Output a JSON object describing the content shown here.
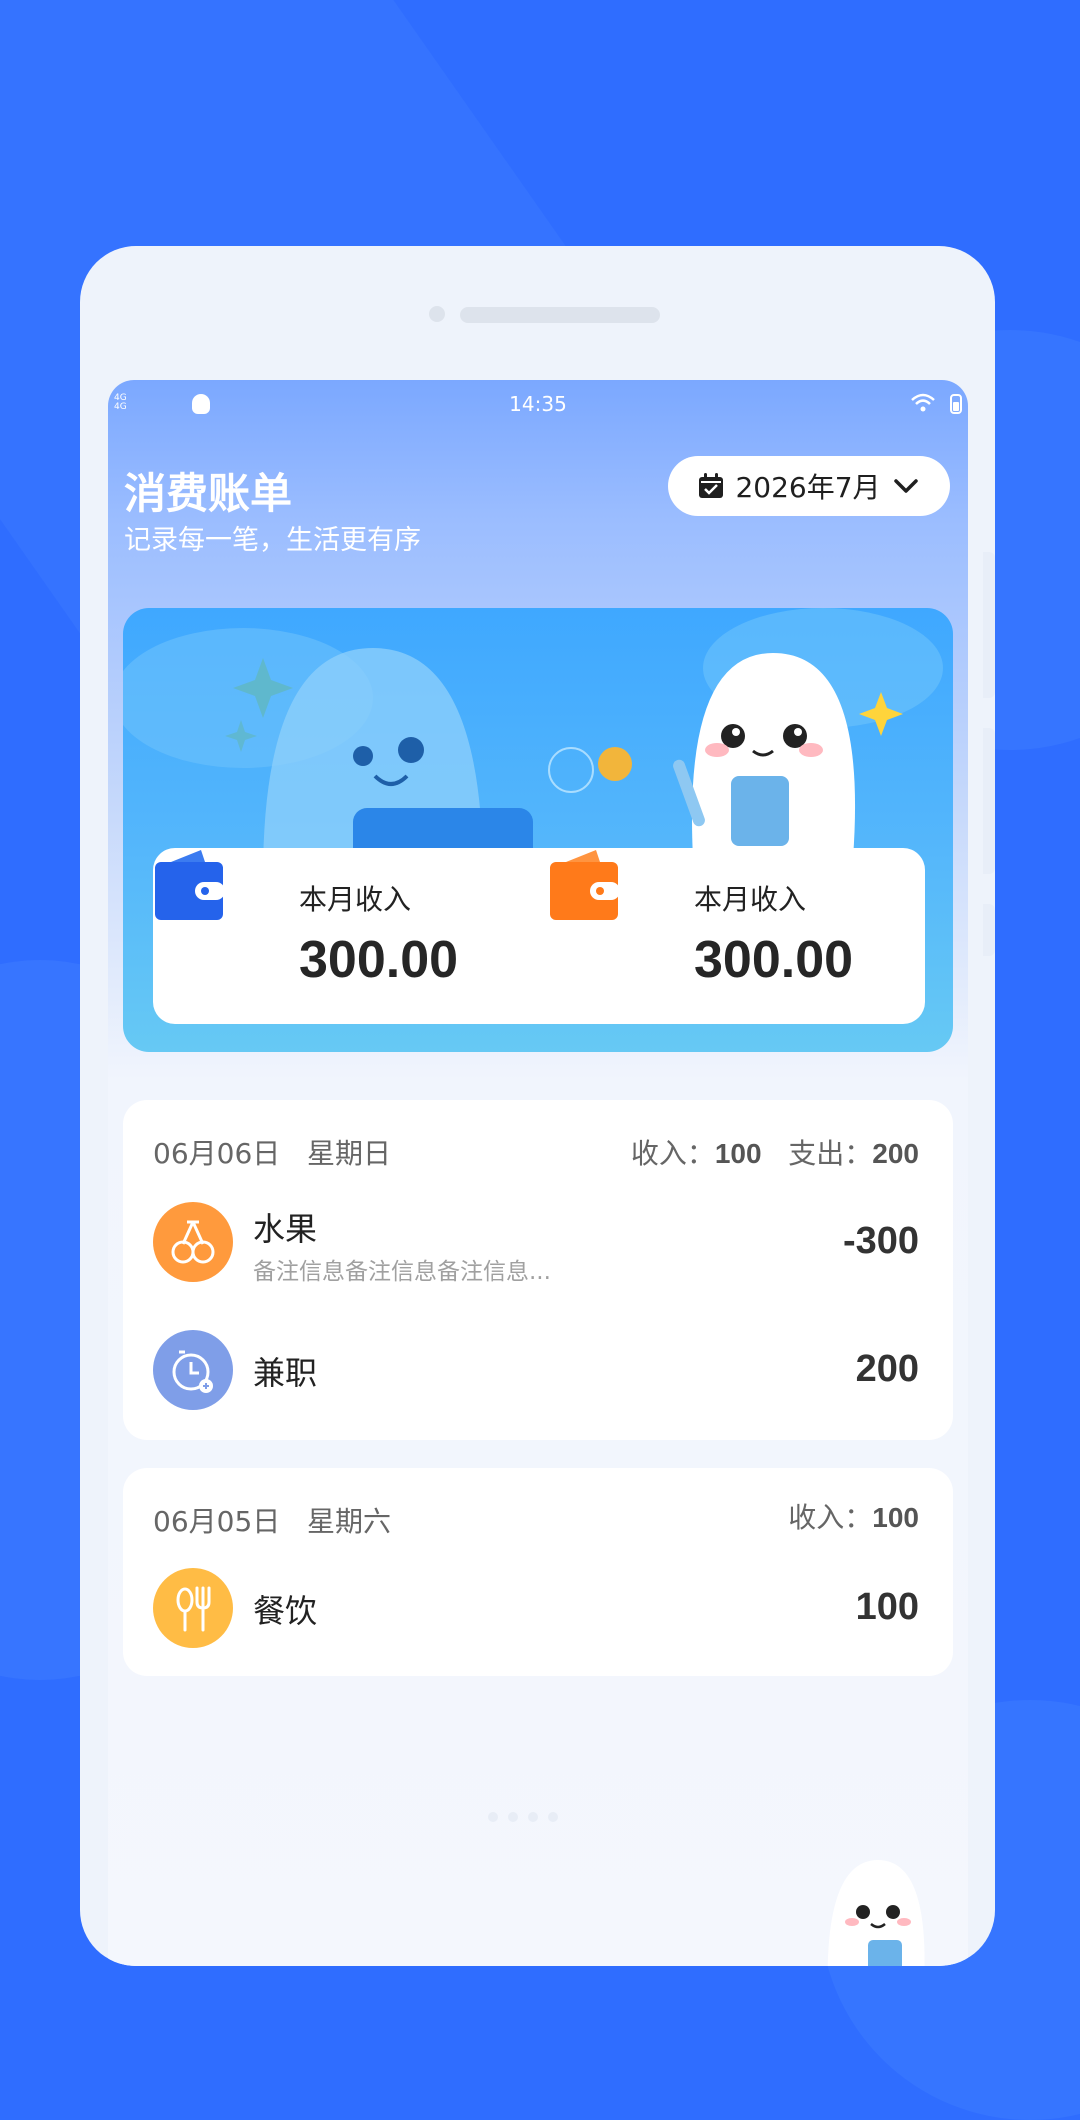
{
  "statusbar": {
    "time": "14:35",
    "network_lines": [
      "4G",
      "4G"
    ]
  },
  "header": {
    "title": "消费账单",
    "subtitle": "记录每一笔，生活更有序",
    "month_label": "2026年7月",
    "icons": [
      "calendar-check-icon",
      "chevron-down-icon"
    ]
  },
  "summary": {
    "left": {
      "label": "本月收入",
      "value": "300.00",
      "icon": "wallet-icon",
      "color": "#2563eb"
    },
    "right": {
      "label": "本月收入",
      "value": "300.00",
      "icon": "wallet-icon",
      "color": "#ff7a1a"
    }
  },
  "days": [
    {
      "date": "06月06日",
      "weekday": "星期日",
      "income_label": "收入：",
      "income": "100",
      "expense_label": "支出：",
      "expense": "200",
      "items": [
        {
          "name": "水果",
          "note": "备注信息备注信息备注信息...",
          "amount": "-300",
          "icon": "cherry-icon",
          "color": "#ff9a3d"
        },
        {
          "name": "兼职",
          "note": "",
          "amount": "200",
          "icon": "clock-icon",
          "color": "#7f9ee8"
        }
      ]
    },
    {
      "date": "06月05日",
      "weekday": "星期六",
      "income_label": "收入：",
      "income": "100",
      "items": [
        {
          "name": "餐饮",
          "note": "",
          "amount": "100",
          "icon": "utensils-icon",
          "color": "#ffbc45"
        }
      ]
    }
  ],
  "colors": {
    "background": "#2f6dff",
    "accent_blue": "#2563eb",
    "accent_orange": "#ff7a1a"
  }
}
